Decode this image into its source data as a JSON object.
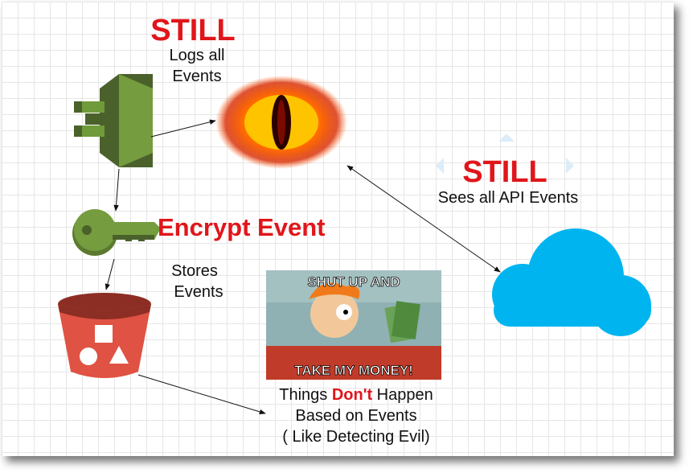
{
  "still_top": "STILL",
  "logs_line1": "Logs all",
  "logs_line2": "Events",
  "encrypt_event": "Encrypt Event",
  "stores_line1": "Stores",
  "stores_line2": "Events",
  "still_right": "STILL",
  "sees_all": "Sees all API Events",
  "meme": {
    "top": "SHUT UP AND",
    "bottom": "TAKE MY MONEY!"
  },
  "caption": {
    "pre": "Things ",
    "emph": "Don't",
    "post": " Happen",
    "line2": "Based on Events",
    "line3": "( Like Detecting Evil)"
  },
  "colors": {
    "accent_red": "#e0161b",
    "cloudtrail_green": "#6f9b3a",
    "s3_red": "#e05243",
    "cloud_blue": "#00b4ef"
  },
  "icons": [
    "cloudtrail-icon",
    "eye-icon",
    "kms-key-icon",
    "s3-bucket-icon",
    "meme-image",
    "cloud-icon"
  ]
}
